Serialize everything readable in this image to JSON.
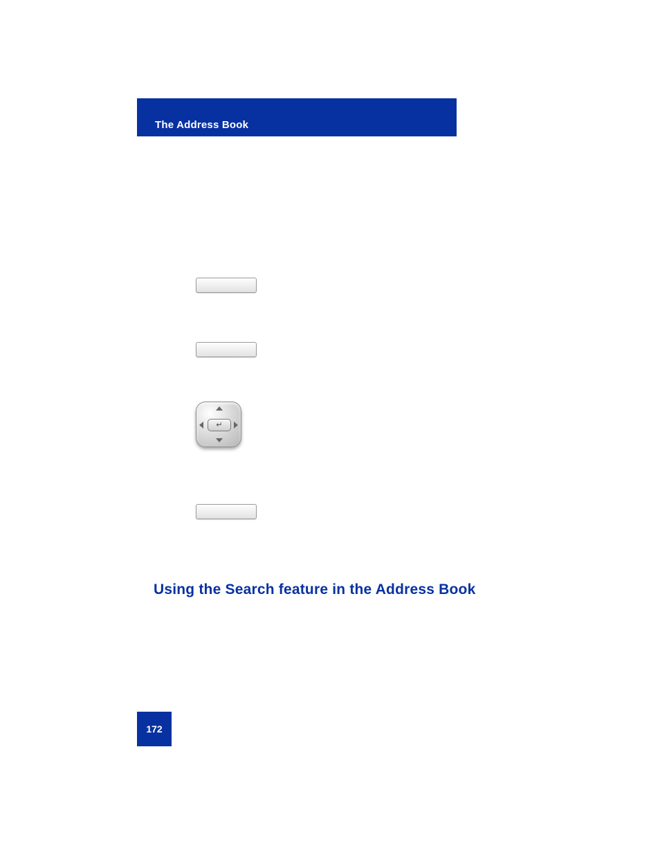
{
  "header": {
    "title": "The Address Book"
  },
  "section": {
    "heading": "Using the Search feature in the Address Book"
  },
  "page_number": "172"
}
